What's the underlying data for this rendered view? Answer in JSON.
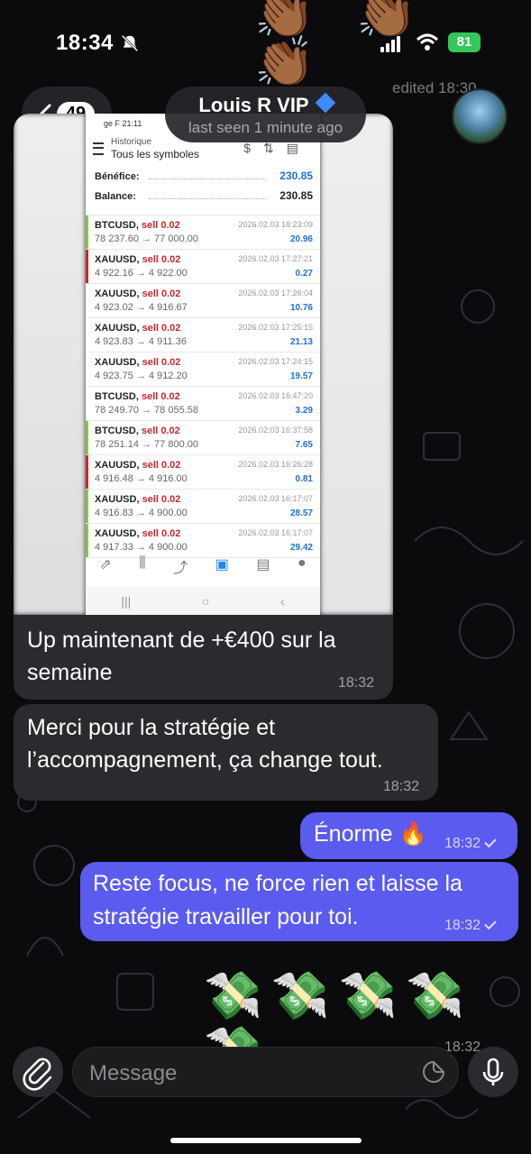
{
  "status": {
    "time": "18:34",
    "battery": "81"
  },
  "header": {
    "back_count": "49",
    "title": "Louis R VIP",
    "subtitle": "last seen 1 minute ago",
    "edited_label": "edited 18:30"
  },
  "screenshot": {
    "status_text": "ge F 21:11",
    "history_label": "Historique",
    "symbols_label": "Tous les symboles",
    "profit_label": "Bénéfice:",
    "profit_value": "230.85",
    "balance_label": "Balance:",
    "balance_value": "230.85",
    "trades": [
      {
        "symbol": "BTCUSD,",
        "side": "sell 0.02",
        "prices": "78 237.60 → 77 000.00",
        "date": "2026.02.03 18:23:09",
        "pl": "20.96",
        "bar": "#8bc34a"
      },
      {
        "symbol": "XAUUSD,",
        "side": "sell 0.02",
        "prices": "4 922.16 → 4 922.00",
        "date": "2026.02.03 17:27:21",
        "pl": "0.27",
        "bar": "#c62828"
      },
      {
        "symbol": "XAUUSD,",
        "side": "sell 0.02",
        "prices": "4 923.02 → 4 916.67",
        "date": "2026.02.03 17:26:04",
        "pl": "10.76",
        "bar": "#ffffff"
      },
      {
        "symbol": "XAUUSD,",
        "side": "sell 0.02",
        "prices": "4 923.83 → 4 911.36",
        "date": "2026.02.03 17:25:15",
        "pl": "21.13",
        "bar": "#ffffff"
      },
      {
        "symbol": "XAUUSD,",
        "side": "sell 0.02",
        "prices": "4 923.75 → 4 912.20",
        "date": "2026.02.03 17:24:15",
        "pl": "19.57",
        "bar": "#ffffff"
      },
      {
        "symbol": "BTCUSD,",
        "side": "sell 0.02",
        "prices": "78 249.70 → 78 055.58",
        "date": "2026.02.03 16:47:20",
        "pl": "3.29",
        "bar": "#ffffff"
      },
      {
        "symbol": "BTCUSD,",
        "side": "sell 0.02",
        "prices": "78 251.14 → 77 800.00",
        "date": "2026.02.03 16:37:58",
        "pl": "7.65",
        "bar": "#8bc34a"
      },
      {
        "symbol": "XAUUSD,",
        "side": "sell 0.02",
        "prices": "4 916.48 → 4 916.00",
        "date": "2026.02.03 16:26:28",
        "pl": "0.81",
        "bar": "#c62828"
      },
      {
        "symbol": "XAUUSD,",
        "side": "sell 0.02",
        "prices": "4 916.83 → 4 900.00",
        "date": "2026.02.03 16:17:07",
        "pl": "28.57",
        "bar": "#8bc34a"
      },
      {
        "symbol": "XAUUSD,",
        "side": "sell 0.02",
        "prices": "4 917.33 → 4 900.00",
        "date": "2026.02.03 16:17:07",
        "pl": "29.42",
        "bar": "#8bc34a"
      }
    ]
  },
  "messages": {
    "caption_text": "Up maintenant de +€400 sur la semaine",
    "caption_time": "18:32",
    "in2_text": "Merci pour la stratégie et l’accompagnement, ça change tout.",
    "in2_time": "18:32",
    "out1_text": "Énorme 🔥",
    "out1_time": "18:32",
    "out2_text": "Reste focus, ne force rien et laisse la stratégie travailler pour toi.",
    "out2_time": "18:32",
    "money_emojis": "💸💸💸💸💸",
    "hands_emojis": "👏🏾👏🏾👏🏾",
    "bottom_edited": "18:32"
  },
  "composer": {
    "placeholder": "Message"
  },
  "colors": {
    "outgoing": "#5b5bf0",
    "incoming": "#2b2b2f",
    "profit": "#1e6fd9"
  }
}
